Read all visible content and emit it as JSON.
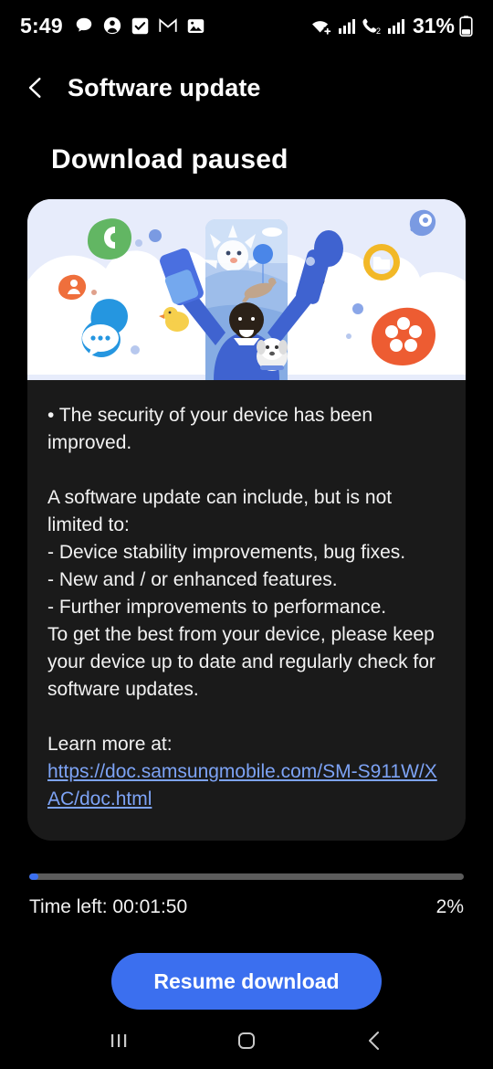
{
  "status_bar": {
    "time": "5:49",
    "battery_percent": "31%",
    "left_icons": [
      "chat-bubble-icon",
      "contact-person-icon",
      "checkbox-icon",
      "gmail-icon",
      "photos-icon"
    ],
    "right_icons": [
      "wifi-icon",
      "signal-bars-icon",
      "volte-call-icon",
      "signal-bars-2-icon",
      "battery-icon"
    ]
  },
  "header": {
    "title": "Software update",
    "back_icon": "chevron-left-icon"
  },
  "page": {
    "title": "Download paused"
  },
  "illustration": {
    "name": "software-update-illustration",
    "background": "#e7ecfb",
    "icons": [
      "phone-app-icon",
      "contacts-app-icon",
      "messages-app-icon",
      "settings-app-icon",
      "my-files-app-icon",
      "gallery-app-icon"
    ]
  },
  "release_notes": {
    "security_bullet": "• The security of your device has been improved.",
    "intro": "A software update can include, but is not limited to:",
    "items": [
      " - Device stability improvements, bug fixes.",
      " - New and / or enhanced features.",
      " - Further improvements to performance."
    ],
    "closing": "To get the best from your device, please keep your device up to date and regularly check for software updates.",
    "learn_more_label": "Learn more at:",
    "learn_more_url": "https://doc.samsungmobile.com/SM-S911W/XAC/doc.html"
  },
  "progress": {
    "percent_value": 2,
    "percent_label": "2%",
    "time_left_label": "Time left: 00:01:50",
    "fill_color": "#3b6fef",
    "track_color": "#5c5c5c"
  },
  "action": {
    "resume_label": "Resume download",
    "accent_color": "#3b6fef"
  },
  "nav_bar": {
    "recents_icon": "recents-icon",
    "home_icon": "home-icon",
    "back_icon": "nav-back-icon"
  }
}
